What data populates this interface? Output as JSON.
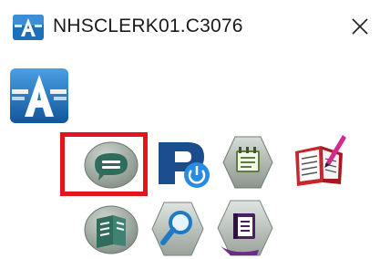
{
  "window": {
    "title": "NHSCLERK01.C3076",
    "close_label": "✕"
  },
  "icons": {
    "title_icon": "app-logo-icon",
    "app_logo": "app-logo-icon",
    "row1": [
      "chat-bubble-icon",
      "power-p-icon",
      "notepad-icon",
      "signing-book-icon"
    ],
    "row2": [
      "speech-book-icon",
      "magnifier-icon",
      "document-stack-icon"
    ]
  },
  "selection": {
    "highlighted_icon": "chat-bubble-icon",
    "highlight_color": "#e2141e"
  },
  "colors": {
    "logo_blue": "#1c6fb8",
    "hex_grey": "#9aa39c"
  }
}
